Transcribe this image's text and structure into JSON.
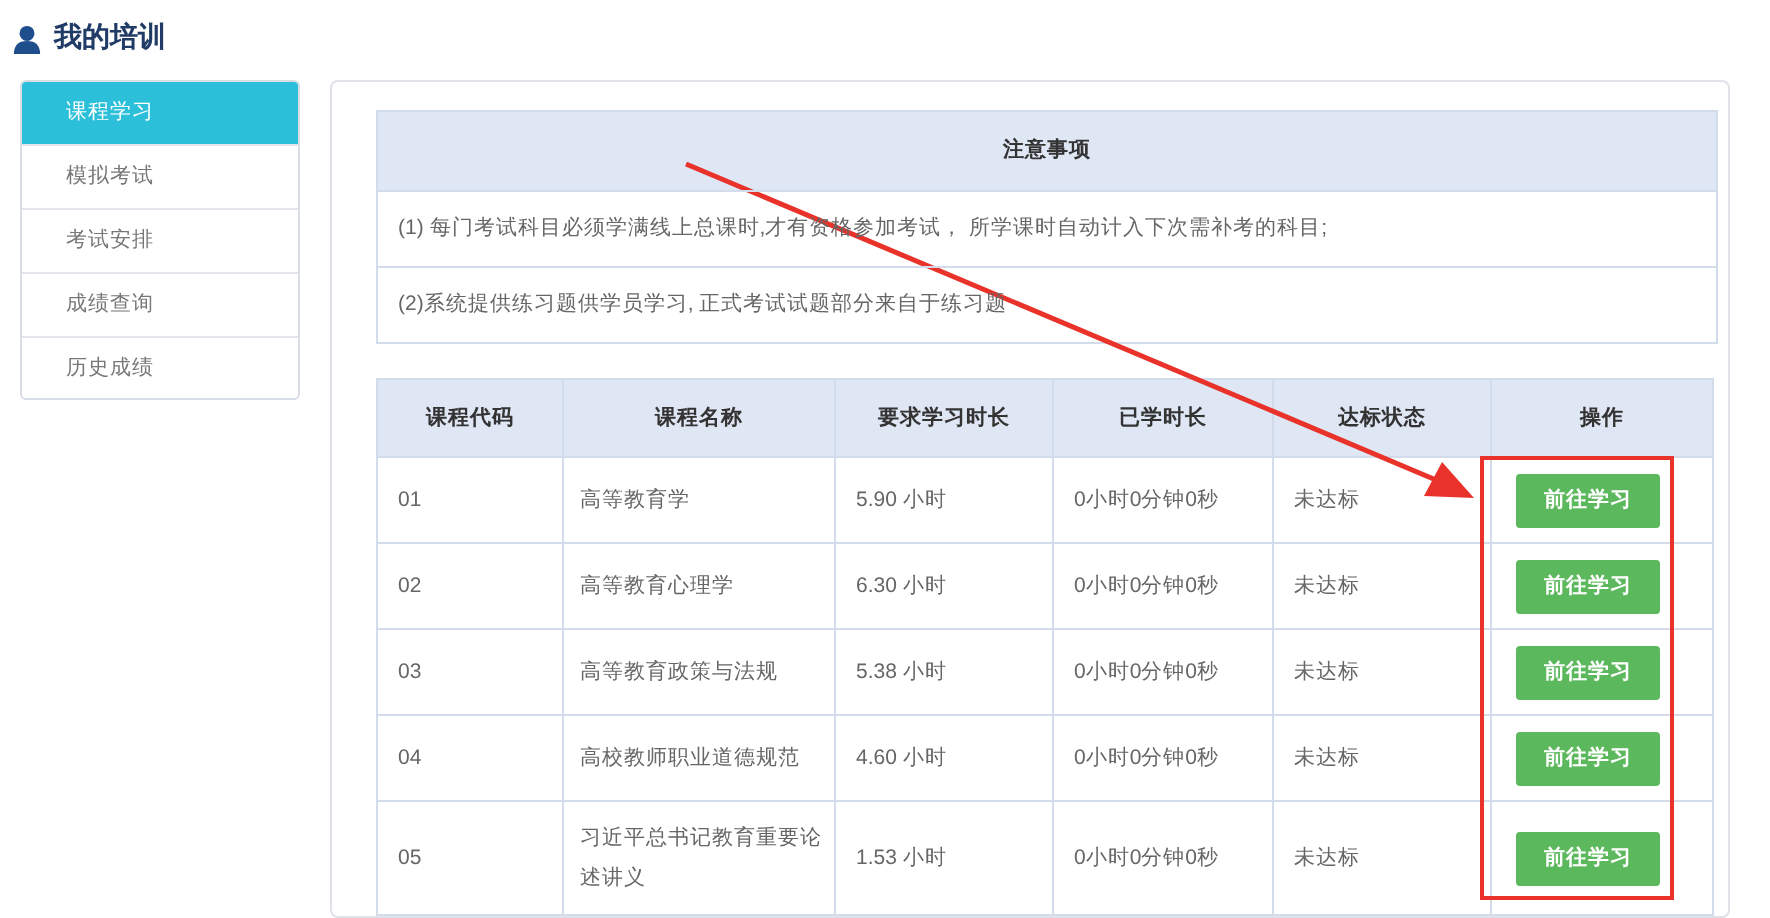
{
  "page_title": "我的培训",
  "sidebar": {
    "items": [
      {
        "label": "课程学习",
        "selected": true
      },
      {
        "label": "模拟考试",
        "selected": false
      },
      {
        "label": "考试安排",
        "selected": false
      },
      {
        "label": "成绩查询",
        "selected": false
      },
      {
        "label": "历史成绩",
        "selected": false
      }
    ]
  },
  "notice": {
    "title": "注意事项",
    "lines": [
      "(1) 每门考试科目必须学满线上总课时,才有资格参加考试， 所学课时自动计入下次需补考的科目;",
      "(2)系统提供练习题供学员学习, 正式考试试题部分来自于练习题"
    ]
  },
  "table": {
    "columns": [
      "课程代码",
      "课程名称",
      "要求学习时长",
      "已学时长",
      "达标状态",
      "操作"
    ],
    "rows": [
      {
        "code": "01",
        "name": "高等教育学",
        "required": "5.90 小时",
        "studied": "0小时0分钟0秒",
        "status": "未达标",
        "action": "前往学习"
      },
      {
        "code": "02",
        "name": "高等教育心理学",
        "required": "6.30 小时",
        "studied": "0小时0分钟0秒",
        "status": "未达标",
        "action": "前往学习"
      },
      {
        "code": "03",
        "name": "高等教育政策与法规",
        "required": "5.38 小时",
        "studied": "0小时0分钟0秒",
        "status": "未达标",
        "action": "前往学习"
      },
      {
        "code": "04",
        "name": "高校教师职业道德规范",
        "required": "4.60 小时",
        "studied": "0小时0分钟0秒",
        "status": "未达标",
        "action": "前往学习"
      },
      {
        "code": "05",
        "name": "习近平总书记教育重要论述讲义",
        "required": "1.53 小时",
        "studied": "0小时0分钟0秒",
        "status": "未达标",
        "action": "前往学习"
      }
    ]
  },
  "annotation_arrow": true,
  "highlight_frame": true
}
